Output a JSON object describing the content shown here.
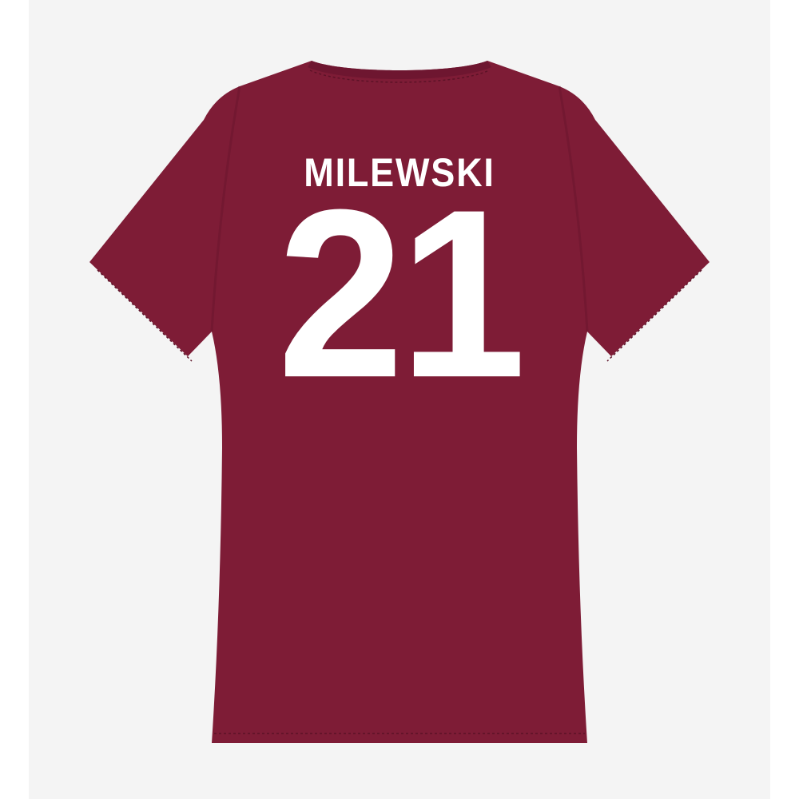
{
  "product": {
    "player_name": "MILEWSKI",
    "player_number": "21"
  },
  "colors": {
    "shirt": "#7e1c36",
    "shirt_shadow": "#6e1630",
    "print": "#ffffff",
    "backdrop": "#f4f4f4"
  },
  "icons": {
    "garment": "tshirt-back-icon"
  }
}
